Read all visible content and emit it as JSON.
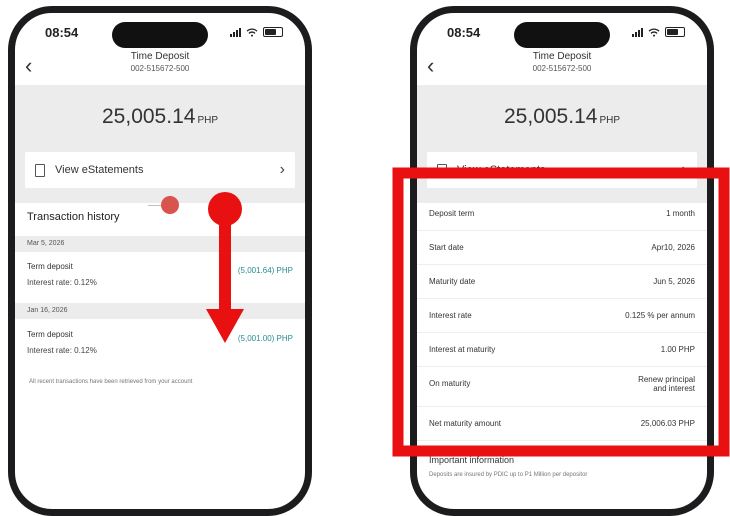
{
  "status_bar": {
    "time": "08:54"
  },
  "header": {
    "title": "Time Deposit",
    "account_number": "002-515672-500",
    "back_icon": "chevron-left-icon"
  },
  "balance": {
    "amount": "25,005.14",
    "currency": "PHP"
  },
  "estatements": {
    "label": "View eStatements"
  },
  "transactions": {
    "title": "Transaction history",
    "groups": [
      {
        "date": "Mar 5, 2026",
        "name": "Term deposit",
        "rate": "Interest rate: 0.12%",
        "amount": "(5,001.64) PHP"
      },
      {
        "date": "Jan 16, 2026",
        "name": "Term deposit",
        "rate": "Interest rate: 0.12%",
        "amount": "(5,001.00) PHP"
      }
    ],
    "footnote": "All recent transactions have been retrieved from your account"
  },
  "details": [
    {
      "label": "Deposit term",
      "value": "1 month"
    },
    {
      "label": "Start date",
      "value": "Apr10, 2026"
    },
    {
      "label": "Maturity date",
      "value": "Jun 5, 2026"
    },
    {
      "label": "Interest rate",
      "value": "0.125 % per annum"
    },
    {
      "label": "Interest at maturity",
      "value": "1.00 PHP"
    },
    {
      "label": "On maturity",
      "value_line1": "Renew principal",
      "value_line2": "and interest"
    },
    {
      "label": "Net maturity amount",
      "value": "25,006.03 PHP"
    }
  ],
  "important": {
    "title": "Important information",
    "body": "Deposits are insured by PDIC up to P1 Million per depositor"
  },
  "colors": {
    "highlight": "#e81010",
    "arrow": "#e81010",
    "amount_teal": "#2b8c8c",
    "page_grey": "#ececec"
  }
}
